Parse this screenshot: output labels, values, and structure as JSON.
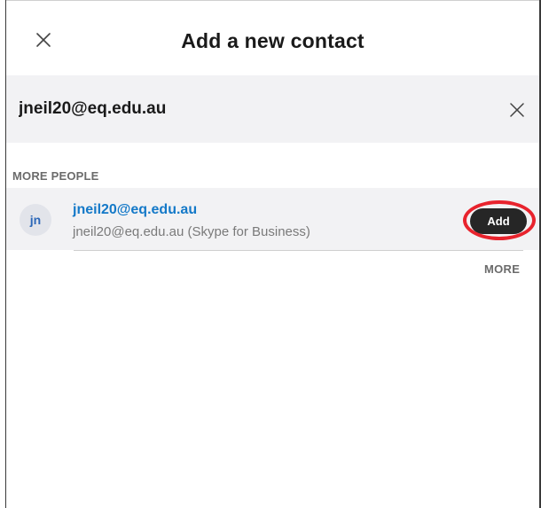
{
  "header": {
    "title": "Add a new contact",
    "close_icon": "close-icon"
  },
  "search": {
    "value": "jneil20@eq.edu.au",
    "clear_icon": "close-icon"
  },
  "section": {
    "label": "MORE PEOPLE"
  },
  "results": [
    {
      "initials": "jn",
      "name": "jneil20@eq.edu.au",
      "subtitle": "jneil20@eq.edu.au (Skype for Business)",
      "action_label": "Add"
    }
  ],
  "more_label": "MORE",
  "colors": {
    "accent_link": "#1479c8",
    "add_button": "#262626",
    "highlight": "#e8232d",
    "row_background": "#f2f2f4"
  }
}
